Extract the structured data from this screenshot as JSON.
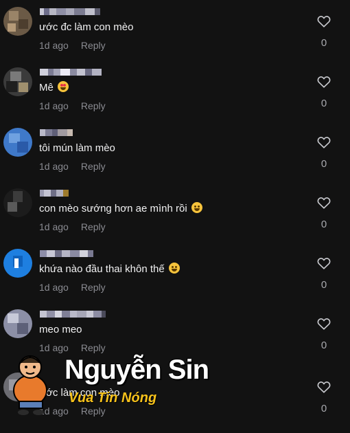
{
  "comments": [
    {
      "text": "ước đc làm con mèo",
      "emoji": "",
      "time": "1d ago",
      "reply": "Reply",
      "likes": "0"
    },
    {
      "text": "Mê",
      "emoji": "heart-eyes-emoji",
      "time": "1d ago",
      "reply": "Reply",
      "likes": "0"
    },
    {
      "text": "tôi mún làm mèo",
      "emoji": "",
      "time": "1d ago",
      "reply": "Reply",
      "likes": "0"
    },
    {
      "text": "con mèo sướng hơn ae mình rồi",
      "emoji": "grinning-sweat-emoji",
      "time": "1d ago",
      "reply": "Reply",
      "likes": "0"
    },
    {
      "text": "khứa nào đầu thai khôn thế",
      "emoji": "laughing-emoji",
      "time": "1d ago",
      "reply": "Reply",
      "likes": "0"
    },
    {
      "text": "meo meo",
      "emoji": "",
      "time": "1d ago",
      "reply": "Reply",
      "likes": "0"
    },
    {
      "text": "ước làm con mèo",
      "emoji": "",
      "time": "1d ago",
      "reply": "Reply",
      "likes": "0"
    }
  ],
  "watermark": {
    "name": "Nguyễn Sin",
    "tagline": "Vua Tin Nóng"
  },
  "colors": {
    "background": "#121212",
    "muted": "#8a8b91",
    "watermark_accent": "#f7c21b"
  }
}
